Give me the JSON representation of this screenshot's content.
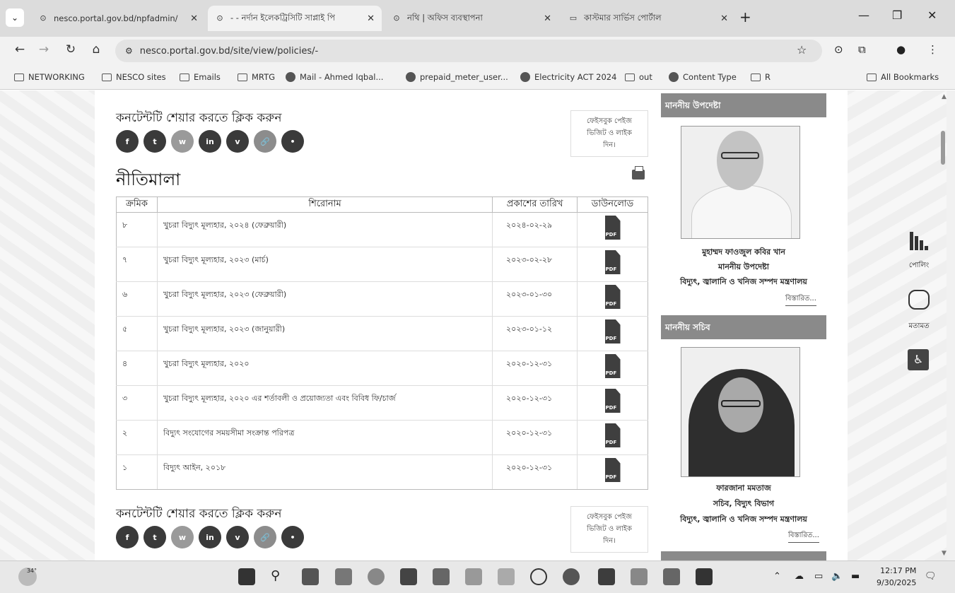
{
  "browser": {
    "tabs": [
      {
        "label": "nesco.portal.gov.bd/npfadmin/",
        "active": false
      },
      {
        "label": "- - নর্দান ইলেকট্রিসিটি সাপ্লাই পি",
        "active": true
      },
      {
        "label": "নথি | অফিস ব্যবস্থাপনা",
        "active": false
      },
      {
        "label": "কাস্টমার সার্ভিস পোর্টাল",
        "active": false
      }
    ],
    "url": "nesco.portal.gov.bd/site/view/policies/-",
    "bookmarks": [
      "NETWORKING",
      "NESCO sites",
      "Emails",
      "MRTG",
      "Mail - Ahmed Iqbal...",
      "prepaid_meter_user...",
      "Electricity ACT 2024",
      "out",
      "Content Type",
      "R"
    ],
    "all_bookmarks": "All Bookmarks"
  },
  "content": {
    "share_title": "কনটেন্টটি শেয়ার করতে ক্লিক করুন",
    "share_buttons": [
      "f",
      "t",
      "w",
      "in",
      "v",
      "🔗",
      "•"
    ],
    "fb_box": [
      "ফেইসবুক পেইজ",
      "ভিজিট ও লাইক",
      "দিন।"
    ],
    "heading": "নীতিমালা",
    "table": {
      "headers": [
        "ক্রমিক",
        "শিরোনাম",
        "প্রকাশের তারিখ",
        "ডাউনলোড"
      ],
      "rows": [
        {
          "serial": "৮",
          "title": "খুচরা বিদ্যুৎ মূল্যহার, ২০২৪ (ফেব্রুয়ারী)",
          "date": "২০২৪-০২-২৯"
        },
        {
          "serial": "৭",
          "title": "খুচরা বিদ্যুৎ মূল্যহার, ২০২৩ (মার্চ)",
          "date": "২০২৩-০২-২৮"
        },
        {
          "serial": "৬",
          "title": "খুচরা বিদ্যুৎ মূল্যহার, ২০২৩ (ফেব্রুয়ারী)",
          "date": "২০২৩-০১-৩০"
        },
        {
          "serial": "৫",
          "title": "খুচরা বিদ্যুৎ মূল্যহার, ২০২৩ (জানুয়ারী)",
          "date": "২০২৩-০১-১২"
        },
        {
          "serial": "৪",
          "title": "খুচরা বিদ্যুৎ মূল্যহার, ২০২০",
          "date": "২০২০-১২-৩১"
        },
        {
          "serial": "৩",
          "title": "খুচরা বিদ্যুৎ মূল্যহার, ২০২০ এর শর্তাবলী ও প্রয়োজ্যতা এবং বিবিধ ফি/চার্জ",
          "date": "২০২০-১২-৩১"
        },
        {
          "serial": "২",
          "title": "বিদ্যুৎ সংযোগের সময়সীমা সংক্রান্ত পরিপত্র",
          "date": "২০২০-১২-৩১"
        },
        {
          "serial": "১",
          "title": "বিদ্যুৎ আইন, ২০১৮",
          "date": "২০২০-১২-৩১"
        }
      ],
      "pdf_label": "PDF"
    }
  },
  "sidebar": {
    "adviser": {
      "heading": "মাননীয় উপদেষ্টা",
      "name": "মুহাম্মদ ফাওজুল কবির খান",
      "designation": "মাননীয় উপদেষ্টা",
      "ministry": "বিদ্যুৎ, জ্বালানি ও খনিজ সম্পদ মন্ত্রণালয়",
      "more": "বিস্তারিত..."
    },
    "secretary": {
      "heading": "মাননীয় সচিব",
      "name": "ফারজানা মমতাজ",
      "designation": "সচিব, বিদ্যুৎ বিভাগ",
      "ministry": "বিদ্যুৎ, জ্বালানি ও খনিজ সম্পদ মন্ত্রণালয়",
      "more": "বিস্তারিত..."
    }
  },
  "floating": {
    "poll": "পোলিং",
    "feedback": "মতামত"
  },
  "taskbar": {
    "temperature": "34°",
    "time": "12:17 PM",
    "date": "9/30/2025"
  }
}
